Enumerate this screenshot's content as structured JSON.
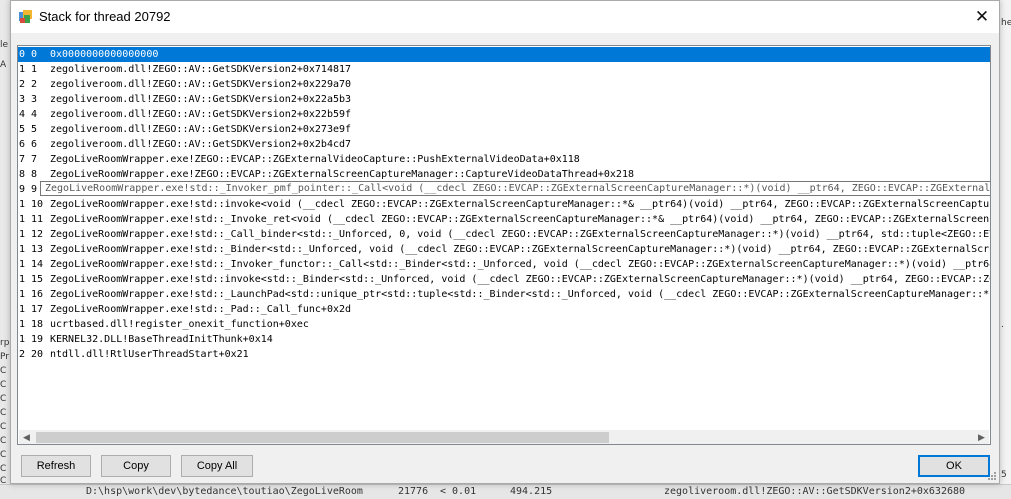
{
  "window": {
    "title": "Stack for thread 20792",
    "close_glyph": "✕",
    "icon": "app-window-icon"
  },
  "frames": [
    {
      "index": "0 0",
      "frame": "0x0000000000000000",
      "selected": true
    },
    {
      "index": "1 1",
      "frame": "zegoliveroom.dll!ZEGO::AV::GetSDKVersion2+0x714817"
    },
    {
      "index": "2 2",
      "frame": "zegoliveroom.dll!ZEGO::AV::GetSDKVersion2+0x229a70"
    },
    {
      "index": "3 3",
      "frame": "zegoliveroom.dll!ZEGO::AV::GetSDKVersion2+0x22a5b3"
    },
    {
      "index": "4 4",
      "frame": "zegoliveroom.dll!ZEGO::AV::GetSDKVersion2+0x22b59f"
    },
    {
      "index": "5 5",
      "frame": "zegoliveroom.dll!ZEGO::AV::GetSDKVersion2+0x273e9f"
    },
    {
      "index": "6 6",
      "frame": "zegoliveroom.dll!ZEGO::AV::GetSDKVersion2+0x2b4cd7"
    },
    {
      "index": "7 7",
      "frame": "ZegoLiveRoomWrapper.exe!ZEGO::EVCAP::ZGExternalVideoCapture::PushExternalVideoData+0x118"
    },
    {
      "index": "8 8",
      "frame": "ZegoLiveRoomWrapper.exe!ZEGO::EVCAP::ZGExternalScreenCaptureManager::CaptureVideoDataThread+0x218"
    },
    {
      "index": "9 9",
      "frame": "ZegoLiveRoomWrapper.exe!std::_Invoker_pmf_pointer::_Call<void (__cdecl ZEGO::EVCAP::ZGExternalScreenCaptureManager::*)(void) __ptr64, ZEGO::EVCAP::ZGExternalScreenCaptureManager"
    },
    {
      "index": "1 10",
      "frame": "ZegoLiveRoomWrapper.exe!std::invoke<void (__cdecl ZEGO::EVCAP::ZGExternalScreenCaptureManager::*& __ptr64)(void) __ptr64, ZEGO::EVCAP::ZGExternalScreenCaptureManager"
    },
    {
      "index": "1 11",
      "frame": "ZegoLiveRoomWrapper.exe!std::_Invoke_ret<void (__cdecl ZEGO::EVCAP::ZGExternalScreenCaptureManager::*& __ptr64)(void) __ptr64, ZEGO::EVCAP::ZGExternalScreenCa"
    },
    {
      "index": "1 12",
      "frame": "ZegoLiveRoomWrapper.exe!std::_Call_binder<std::_Unforced, 0, void (__cdecl ZEGO::EVCAP::ZGExternalScreenCaptureManager::*)(void) __ptr64, std::tuple<ZEGO::EVCAP"
    },
    {
      "index": "1 13",
      "frame": "ZegoLiveRoomWrapper.exe!std::_Binder<std::_Unforced, void (__cdecl ZEGO::EVCAP::ZGExternalScreenCaptureManager::*)(void) __ptr64, ZEGO::EVCAP::ZGExternalScreen"
    },
    {
      "index": "1 14",
      "frame": "ZegoLiveRoomWrapper.exe!std::_Invoker_functor::_Call<std::_Binder<std::_Unforced, void (__cdecl ZEGO::EVCAP::ZGExternalScreenCaptureManager::*)(void) __ptr64,"
    },
    {
      "index": "1 15",
      "frame": "ZegoLiveRoomWrapper.exe!std::invoke<std::_Binder<std::_Unforced, void (__cdecl ZEGO::EVCAP::ZGExternalScreenCaptureManager::*)(void) __ptr64, ZEGO::EVCAP::ZGEx"
    },
    {
      "index": "1 16",
      "frame": "ZegoLiveRoomWrapper.exe!std::_LaunchPad<std::unique_ptr<std::tuple<std::_Binder<std::_Unforced, void (__cdecl ZEGO::EVCAP::ZGExternalScreenCaptureManager::*) ("
    },
    {
      "index": "1 17",
      "frame": "ZegoLiveRoomWrapper.exe!std::_Pad::_Call_func+0x2d"
    },
    {
      "index": "1 18",
      "frame": "ucrtbased.dll!register_onexit_function+0xec"
    },
    {
      "index": "1 19",
      "frame": "KERNEL32.DLL!BaseThreadInitThunk+0x14"
    },
    {
      "index": "2 20",
      "frame": "ntdll.dll!RtlUserThreadStart+0x21"
    }
  ],
  "tooltip": "ZegoLiveRoomWrapper.exe!std::_Invoker_pmf_pointer::_Call<void (__cdecl ZEGO::EVCAP::ZGExternalScreenCaptureManager::*)(void) __ptr64, ZEGO::EVCAP::ZGExternalScreenCaptureManager",
  "buttons": {
    "refresh": "Refresh",
    "copy": "Copy",
    "copy_all": "Copy All",
    "ok": "OK"
  },
  "scrollbar": {
    "left_arrow": "◀",
    "right_arrow": "▶"
  },
  "background": {
    "left_chars": [
      "le",
      "A",
      "rp",
      "Pr",
      "C",
      "C",
      "C",
      "C",
      "C",
      "C",
      "C",
      "C",
      "C"
    ],
    "right_chars": [
      "he",
      "5",
      "."
    ],
    "bottom_path": "D:\\hsp\\work\\dev\\bytedance\\toutiao\\ZegoLiveRoom",
    "bottom_id": "21776",
    "bottom_lt": "< 0.01",
    "bottom_size": "494.215",
    "bottom_frame": "zegoliveroom.dll!ZEGO::AV::GetSDKVersion2+0x632680"
  },
  "colors": {
    "selection": "#0078d7",
    "accent": "#0078d7"
  }
}
